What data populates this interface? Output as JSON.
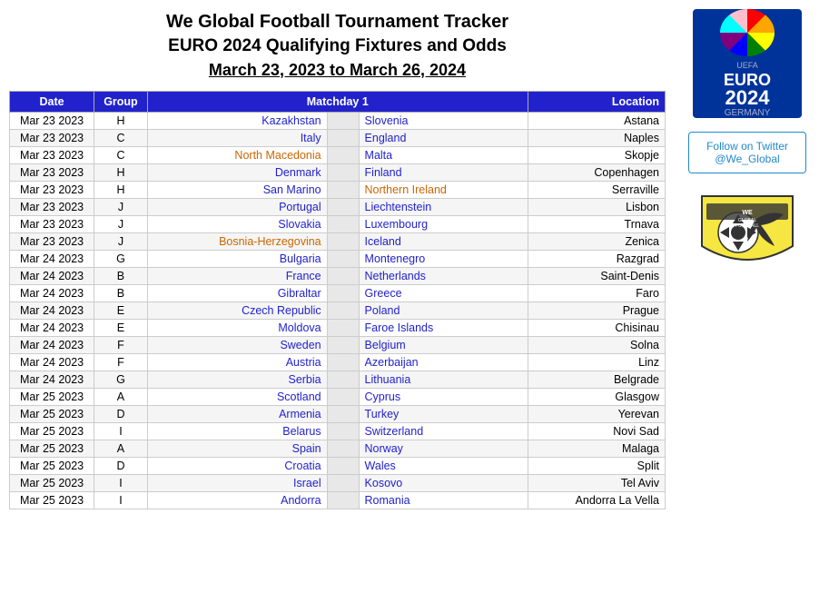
{
  "header": {
    "line1": "We Global Football Tournament Tracker",
    "line2": "EURO 2024 Qualifying Fixtures and Odds",
    "line3": "March 23, 2023 to March 26, 2024"
  },
  "table": {
    "columns": [
      "Date",
      "Group",
      "Matchday 1",
      "",
      "",
      "Location"
    ],
    "rows": [
      {
        "date": "Mar 23 2023",
        "group": "H",
        "home": "Kazakhstan",
        "away": "Slovenia",
        "location": "Astana",
        "homeColor": "blue",
        "awayColor": "black"
      },
      {
        "date": "Mar 23 2023",
        "group": "C",
        "home": "Italy",
        "away": "England",
        "location": "Naples",
        "homeColor": "blue",
        "awayColor": "black"
      },
      {
        "date": "Mar 23 2023",
        "group": "C",
        "home": "North Macedonia",
        "away": "Malta",
        "location": "Skopje",
        "homeColor": "orange",
        "awayColor": "black"
      },
      {
        "date": "Mar 23 2023",
        "group": "H",
        "home": "Denmark",
        "away": "Finland",
        "location": "Copenhagen",
        "homeColor": "blue",
        "awayColor": "black"
      },
      {
        "date": "Mar 23 2023",
        "group": "H",
        "home": "San Marino",
        "away": "Northern Ireland",
        "location": "Serraville",
        "homeColor": "blue",
        "awayColor": "orange"
      },
      {
        "date": "Mar 23 2023",
        "group": "J",
        "home": "Portugal",
        "away": "Liechtenstein",
        "location": "Lisbon",
        "homeColor": "blue",
        "awayColor": "black"
      },
      {
        "date": "Mar 23 2023",
        "group": "J",
        "home": "Slovakia",
        "away": "Luxembourg",
        "location": "Trnava",
        "homeColor": "blue",
        "awayColor": "black"
      },
      {
        "date": "Mar 23 2023",
        "group": "J",
        "home": "Bosnia-Herzegovina",
        "away": "Iceland",
        "location": "Zenica",
        "homeColor": "orange",
        "awayColor": "black"
      },
      {
        "date": "Mar 24 2023",
        "group": "G",
        "home": "Bulgaria",
        "away": "Montenegro",
        "location": "Razgrad",
        "homeColor": "blue",
        "awayColor": "black"
      },
      {
        "date": "Mar 24 2023",
        "group": "B",
        "home": "France",
        "away": "Netherlands",
        "location": "Saint-Denis",
        "homeColor": "blue",
        "awayColor": "black"
      },
      {
        "date": "Mar 24 2023",
        "group": "B",
        "home": "Gibraltar",
        "away": "Greece",
        "location": "Faro",
        "homeColor": "blue",
        "awayColor": "black"
      },
      {
        "date": "Mar 24 2023",
        "group": "E",
        "home": "Czech Republic",
        "away": "Poland",
        "location": "Prague",
        "homeColor": "blue",
        "awayColor": "black"
      },
      {
        "date": "Mar 24 2023",
        "group": "E",
        "home": "Moldova",
        "away": "Faroe Islands",
        "location": "Chisinau",
        "homeColor": "blue",
        "awayColor": "black"
      },
      {
        "date": "Mar 24 2023",
        "group": "F",
        "home": "Sweden",
        "away": "Belgium",
        "location": "Solna",
        "homeColor": "blue",
        "awayColor": "black"
      },
      {
        "date": "Mar 24 2023",
        "group": "F",
        "home": "Austria",
        "away": "Azerbaijan",
        "location": "Linz",
        "homeColor": "blue",
        "awayColor": "black"
      },
      {
        "date": "Mar 24 2023",
        "group": "G",
        "home": "Serbia",
        "away": "Lithuania",
        "location": "Belgrade",
        "homeColor": "blue",
        "awayColor": "black"
      },
      {
        "date": "Mar 25 2023",
        "group": "A",
        "home": "Scotland",
        "away": "Cyprus",
        "location": "Glasgow",
        "homeColor": "blue",
        "awayColor": "black"
      },
      {
        "date": "Mar 25 2023",
        "group": "D",
        "home": "Armenia",
        "away": "Turkey",
        "location": "Yerevan",
        "homeColor": "blue",
        "awayColor": "black"
      },
      {
        "date": "Mar 25 2023",
        "group": "I",
        "home": "Belarus",
        "away": "Switzerland",
        "location": "Novi Sad",
        "homeColor": "blue",
        "awayColor": "black"
      },
      {
        "date": "Mar 25 2023",
        "group": "A",
        "home": "Spain",
        "away": "Norway",
        "location": "Malaga",
        "homeColor": "blue",
        "awayColor": "black"
      },
      {
        "date": "Mar 25 2023",
        "group": "D",
        "home": "Croatia",
        "away": "Wales",
        "location": "Split",
        "homeColor": "blue",
        "awayColor": "black"
      },
      {
        "date": "Mar 25 2023",
        "group": "I",
        "home": "Israel",
        "away": "Kosovo",
        "location": "Tel Aviv",
        "homeColor": "blue",
        "awayColor": "black"
      },
      {
        "date": "Mar 25 2023",
        "group": "I",
        "home": "Andorra",
        "away": "Romania",
        "location": "Andorra La Vella",
        "homeColor": "blue",
        "awayColor": "black"
      }
    ]
  },
  "sidebar": {
    "twitter_label": "Follow on Twitter",
    "twitter_handle": "@We_Global",
    "twitter_url": "#"
  }
}
